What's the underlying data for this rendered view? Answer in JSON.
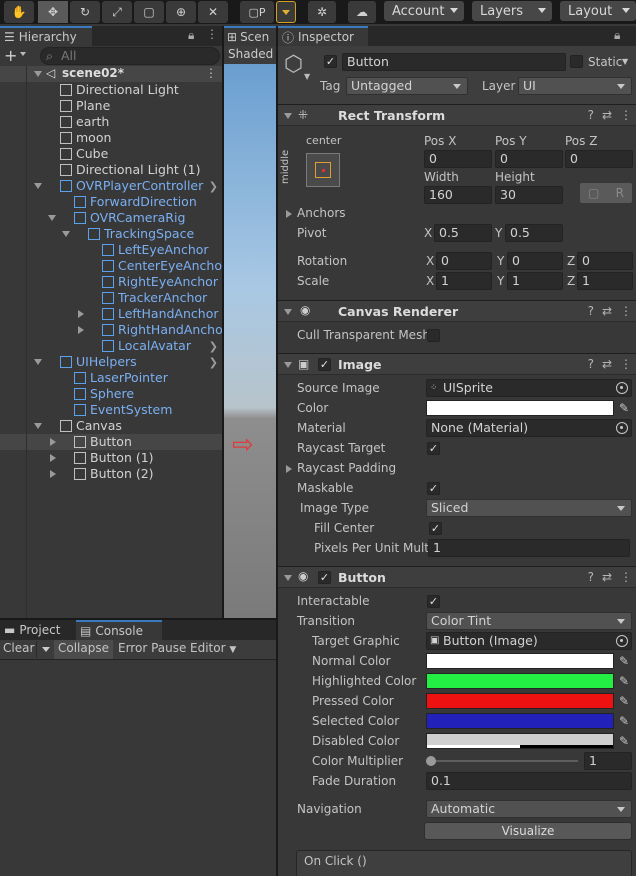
{
  "toolbar": {
    "play_label": "P",
    "account": "Account",
    "layers": "Layers",
    "layout": "Layout"
  },
  "hierarchy": {
    "tab": "Hierarchy",
    "add": "+",
    "search_placeholder": "All",
    "scene": "scene02*",
    "items": [
      {
        "label": "Directional Light",
        "indent": 0,
        "blue": false,
        "exp": "",
        "chev": false
      },
      {
        "label": "Plane",
        "indent": 0,
        "blue": false,
        "exp": "",
        "chev": false
      },
      {
        "label": "earth",
        "indent": 0,
        "blue": false,
        "exp": "",
        "chev": false
      },
      {
        "label": "moon",
        "indent": 0,
        "blue": false,
        "exp": "",
        "chev": false
      },
      {
        "label": "Cube",
        "indent": 0,
        "blue": false,
        "exp": "",
        "chev": false
      },
      {
        "label": "Directional Light (1)",
        "indent": 0,
        "blue": false,
        "exp": "",
        "chev": false
      },
      {
        "label": "OVRPlayerController",
        "indent": 0,
        "blue": true,
        "exp": "down",
        "chev": true
      },
      {
        "label": "ForwardDirection",
        "indent": 1,
        "blue": true,
        "exp": "",
        "chev": false
      },
      {
        "label": "OVRCameraRig",
        "indent": 1,
        "blue": true,
        "exp": "down",
        "chev": false
      },
      {
        "label": "TrackingSpace",
        "indent": 2,
        "blue": true,
        "exp": "down",
        "chev": false
      },
      {
        "label": "LeftEyeAnchor",
        "indent": 3,
        "blue": true,
        "exp": "",
        "chev": false
      },
      {
        "label": "CenterEyeAnchor",
        "indent": 3,
        "blue": true,
        "exp": "",
        "chev": false
      },
      {
        "label": "RightEyeAnchor",
        "indent": 3,
        "blue": true,
        "exp": "",
        "chev": false
      },
      {
        "label": "TrackerAnchor",
        "indent": 3,
        "blue": true,
        "exp": "",
        "chev": false
      },
      {
        "label": "LeftHandAnchor",
        "indent": 3,
        "blue": true,
        "exp": "right",
        "chev": false
      },
      {
        "label": "RightHandAnchor",
        "indent": 3,
        "blue": true,
        "exp": "right",
        "chev": false
      },
      {
        "label": "LocalAvatar",
        "indent": 3,
        "blue": true,
        "exp": "",
        "chev": true
      },
      {
        "label": "UIHelpers",
        "indent": 0,
        "blue": true,
        "exp": "down",
        "chev": true
      },
      {
        "label": "LaserPointer",
        "indent": 1,
        "blue": true,
        "exp": "",
        "chev": false
      },
      {
        "label": "Sphere",
        "indent": 1,
        "blue": true,
        "exp": "",
        "chev": false
      },
      {
        "label": "EventSystem",
        "indent": 1,
        "blue": true,
        "exp": "",
        "chev": false
      },
      {
        "label": "Canvas",
        "indent": 0,
        "blue": false,
        "exp": "down",
        "chev": false
      },
      {
        "label": "Button",
        "indent": 1,
        "blue": false,
        "exp": "right",
        "chev": false,
        "sel": true
      },
      {
        "label": "Button (1)",
        "indent": 1,
        "blue": false,
        "exp": "right",
        "chev": false
      },
      {
        "label": "Button (2)",
        "indent": 1,
        "blue": false,
        "exp": "right",
        "chev": false
      }
    ]
  },
  "scene": {
    "tab": "Scen",
    "shading": "Shaded"
  },
  "bottom": {
    "project_tab": "Project",
    "console_tab": "Console",
    "clear": "Clear",
    "collapse": "Collapse",
    "error_pause": "Error Pause",
    "editor": "Editor"
  },
  "inspector": {
    "tab": "Inspector",
    "name": "Button",
    "static": "Static",
    "tag_label": "Tag",
    "tag": "Untagged",
    "layer_label": "Layer",
    "layer": "UI",
    "rect": {
      "title": "Rect Transform",
      "anchor_h": "center",
      "anchor_v": "middle",
      "posx_l": "Pos X",
      "posy_l": "Pos Y",
      "posz_l": "Pos Z",
      "posx": "0",
      "posy": "0",
      "posz": "0",
      "width_l": "Width",
      "height_l": "Height",
      "width": "160",
      "height": "30",
      "r_btn": "R",
      "anchors": "Anchors",
      "pivot": "Pivot",
      "pivot_x": "0.5",
      "pivot_y": "0.5",
      "rotation": "Rotation",
      "rot_x": "0",
      "rot_y": "0",
      "rot_z": "0",
      "scale": "Scale",
      "sc_x": "1",
      "sc_y": "1",
      "sc_z": "1",
      "x": "X",
      "y": "Y",
      "z": "Z"
    },
    "canvas_renderer": {
      "title": "Canvas Renderer",
      "cull": "Cull Transparent Mesh"
    },
    "image": {
      "title": "Image",
      "source_l": "Source Image",
      "source": "UISprite",
      "color_l": "Color",
      "material_l": "Material",
      "material": "None (Material)",
      "raycast_target": "Raycast Target",
      "raycast_padding": "Raycast Padding",
      "maskable": "Maskable",
      "image_type_l": "Image Type",
      "image_type": "Sliced",
      "fill_center": "Fill Center",
      "ppu_l": "Pixels Per Unit Multi",
      "ppu": "1"
    },
    "button": {
      "title": "Button",
      "interactable": "Interactable",
      "transition_l": "Transition",
      "transition": "Color Tint",
      "target_l": "Target Graphic",
      "target": "Button (Image)",
      "normal_l": "Normal Color",
      "highlighted_l": "Highlighted Color",
      "pressed_l": "Pressed Color",
      "selected_l": "Selected Color",
      "disabled_l": "Disabled Color",
      "multiplier_l": "Color Multiplier",
      "multiplier": "1",
      "multiplier_fraction": 0.0,
      "fade_l": "Fade Duration",
      "fade": "0.1",
      "nav_l": "Navigation",
      "nav": "Automatic",
      "visualize": "Visualize",
      "onclick": "On Click ()",
      "colors": {
        "normal": "#ffffff",
        "highlighted": "#22ee44",
        "pressed": "#ee1111",
        "selected": "#2222bb",
        "disabled": "#cfcfcf"
      }
    }
  }
}
